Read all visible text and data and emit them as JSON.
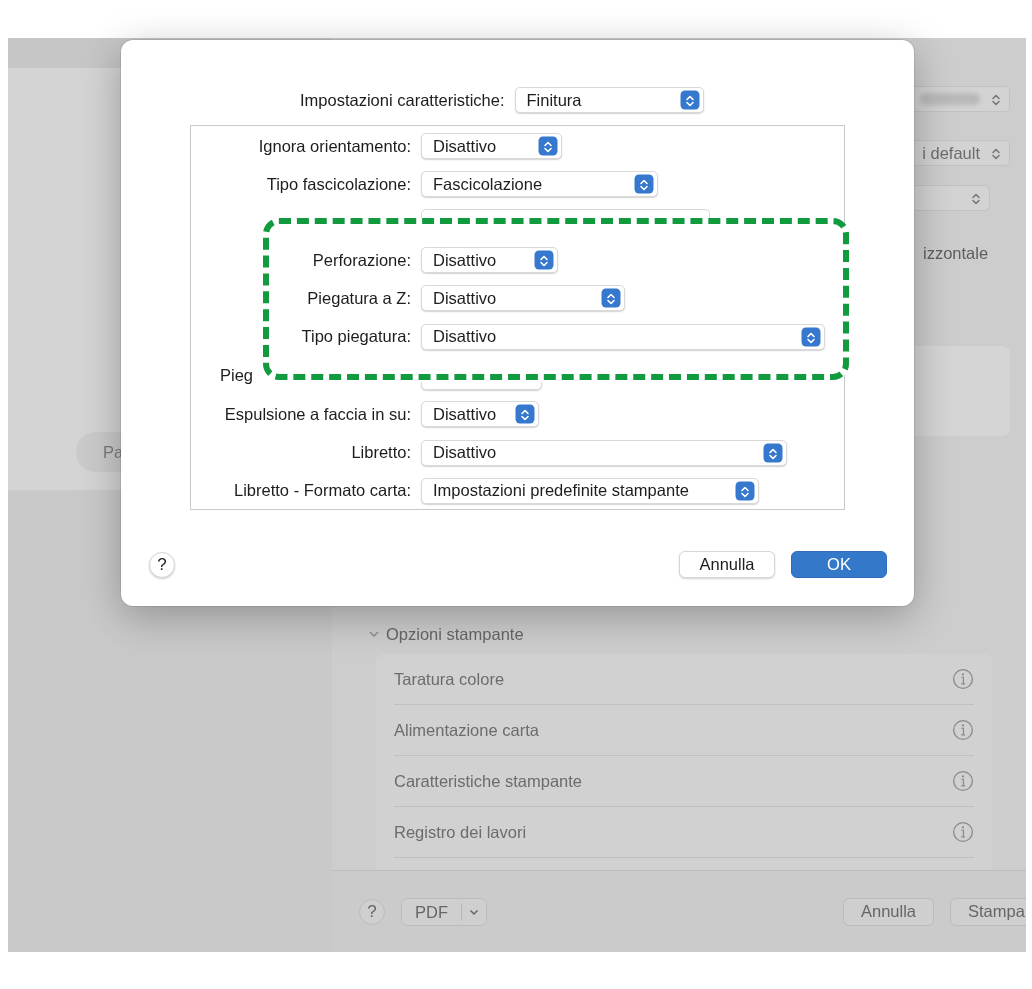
{
  "background": {
    "presets_popup": {
      "value": "i default"
    },
    "orientation_text": "izzontale",
    "side_button": "Pa",
    "printer_options": {
      "title": "Opzioni stampante",
      "expanded": true,
      "items": [
        "Taratura colore",
        "Alimentazione carta",
        "Caratteristiche stampante",
        "Registro dei lavori"
      ]
    },
    "footer": {
      "help": "?",
      "pdf": "PDF",
      "cancel": "Annulla",
      "print": "Stampa"
    }
  },
  "dialog": {
    "feature_set": {
      "label": "Impostazioni caratteristiche:",
      "value": "Finitura"
    },
    "rows": [
      {
        "kind": "field",
        "label": "Ignora orientamento:",
        "value": "Disattivo"
      },
      {
        "kind": "field",
        "label": "Tipo fascicolazione:",
        "value": "Fascicolazione"
      },
      {
        "kind": "covered"
      },
      {
        "kind": "hidden"
      },
      {
        "kind": "hidden"
      },
      {
        "kind": "hidden"
      },
      {
        "kind": "covered",
        "label": "Pieg"
      },
      {
        "kind": "field",
        "label": "Espulsione a faccia in su:",
        "value": "Disattivo"
      },
      {
        "kind": "field",
        "label": "Libretto:",
        "value": "Disattivo"
      },
      {
        "kind": "field",
        "label": "Libretto - Formato carta:",
        "value": "Impostazioni predefinite stampante"
      }
    ],
    "highlight": {
      "rows": [
        {
          "label": "Perforazione:",
          "value": "Disattivo"
        },
        {
          "label": "Piegatura a Z:",
          "value": "Disattivo"
        },
        {
          "label": "Tipo piegatura:",
          "value": "Disattivo"
        }
      ]
    },
    "help": "?",
    "cancel": "Annulla",
    "ok": "OK"
  }
}
